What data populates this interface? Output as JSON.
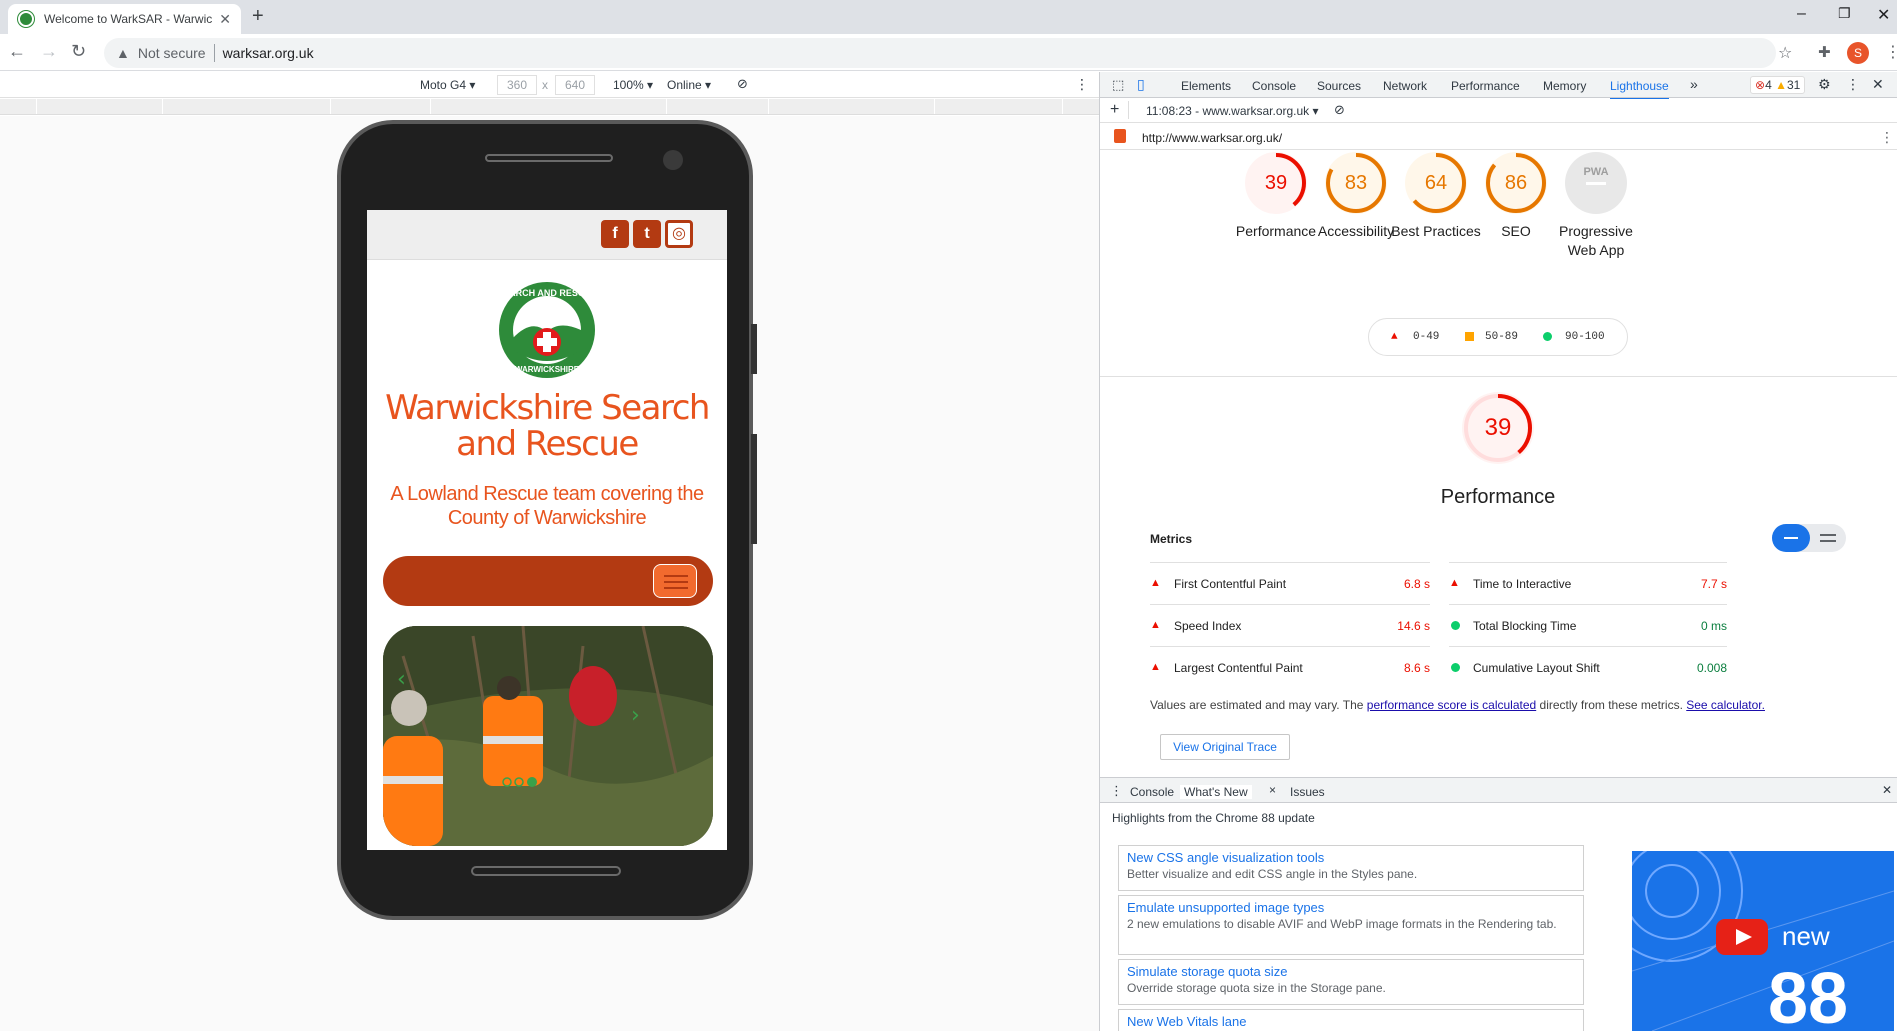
{
  "browser": {
    "tab_title": "Welcome to WarkSAR - Warwick",
    "not_secure": "Not secure",
    "url": "warksar.org.uk"
  },
  "device_toolbar": {
    "device": "Moto G4 ▾",
    "width": "360",
    "x": "x",
    "height": "640",
    "zoom": "100% ▾",
    "network": "Online ▾"
  },
  "site": {
    "title": "Warwickshire Search and Rescue",
    "subtitle": "A Lowland Rescue team covering the County of Warwickshire",
    "logo_top_text": "SEARCH AND RESCUE",
    "logo_bottom_text": "WARWICKSHIRE",
    "social_icons": [
      "facebook-icon",
      "twitter-icon",
      "instagram-icon"
    ],
    "brand_color": "#b33a12",
    "title_color": "#e8541e"
  },
  "devtools": {
    "tabs": [
      "Elements",
      "Console",
      "Sources",
      "Network",
      "Performance",
      "Memory",
      "Lighthouse"
    ],
    "more": "»",
    "active_tab": "Lighthouse",
    "errors": "4",
    "warnings": "31",
    "report_selector": "11:08:23 - www.warksar.org.uk ▾",
    "report_url": "http://www.warksar.org.uk/"
  },
  "lighthouse": {
    "scores": [
      {
        "label": "Performance",
        "value": "39",
        "color": "#eb0f00"
      },
      {
        "label": "Accessibility",
        "value": "83",
        "color": "#e67700"
      },
      {
        "label": "Best Practices",
        "value": "64",
        "color": "#e67700"
      },
      {
        "label": "SEO",
        "value": "86",
        "color": "#e67700"
      },
      {
        "label": "Progressive Web App",
        "value": "PWA",
        "color": "#9e9e9e"
      }
    ],
    "legend": [
      "0-49",
      "50-89",
      "90-100"
    ],
    "main_score": "39",
    "main_label": "Performance",
    "metrics_heading": "Metrics",
    "metrics": [
      {
        "name": "First Contentful Paint",
        "value": "6.8 s",
        "status": "fail"
      },
      {
        "name": "Time to Interactive",
        "value": "7.7 s",
        "status": "fail"
      },
      {
        "name": "Speed Index",
        "value": "14.6 s",
        "status": "fail"
      },
      {
        "name": "Total Blocking Time",
        "value": "0 ms",
        "status": "pass"
      },
      {
        "name": "Largest Contentful Paint",
        "value": "8.6 s",
        "status": "fail"
      },
      {
        "name": "Cumulative Layout Shift",
        "value": "0.008",
        "status": "pass"
      }
    ],
    "note_prefix": "Values are estimated and may vary. The ",
    "note_link1": "performance score is calculated",
    "note_mid": " directly from these metrics. ",
    "note_link2": "See calculator.",
    "trace_button": "View Original Trace"
  },
  "drawer": {
    "tabs": [
      "Console",
      "What's New",
      "Issues"
    ],
    "close": "×",
    "heading": "Highlights from the Chrome 88 update",
    "cards": [
      {
        "title": "New CSS angle visualization tools",
        "desc": "Better visualize and edit CSS angle in the Styles pane."
      },
      {
        "title": "Emulate unsupported image types",
        "desc": "2 new emulations to disable AVIF and WebP image formats in the Rendering tab."
      },
      {
        "title": "Simulate storage quota size",
        "desc": "Override storage quota size in the Storage pane."
      },
      {
        "title": "New Web Vitals lane",
        "desc": ""
      }
    ],
    "promo_new": "new",
    "promo_version": "88"
  }
}
